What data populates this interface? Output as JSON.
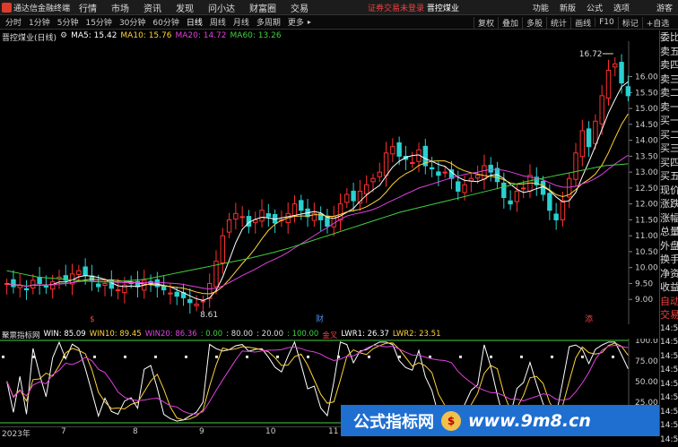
{
  "menubar": {
    "logo": "通达信金融终端",
    "items": [
      "行情",
      "市场",
      "资讯",
      "发现",
      "问小达",
      "财富圈",
      "交易"
    ],
    "notice": "证券交易未登录",
    "stock_notice": "晋控煤业",
    "right": [
      "功能",
      "新版",
      "公式",
      "选项",
      "游客"
    ]
  },
  "toolbar": {
    "periods": [
      "分时",
      "1分钟",
      "5分钟",
      "15分钟",
      "30分钟",
      "60分钟",
      "日线",
      "周线",
      "月线",
      "多周期",
      "更多"
    ],
    "active_period": "日线",
    "right": [
      "复权",
      "叠加",
      "多股",
      "统计",
      "画线",
      "F10",
      "标记",
      "+自选"
    ]
  },
  "title": {
    "stock": "晋控煤业(日线)",
    "ma5": "MA5: 15.42",
    "ma10": "MA10: 15.76",
    "ma20": "MA20: 14.72",
    "ma60": "MA60: 13.26"
  },
  "colors": {
    "ma5": "#ffffff",
    "ma10": "#ffd23a",
    "ma20": "#e040e0",
    "ma60": "#40d040",
    "up": "#ff3030",
    "down": "#2ad0d0"
  },
  "price_labels": {
    "high": "16.72",
    "low": "8.61"
  },
  "yaxis": [
    "16.00",
    "15.50",
    "15.00",
    "14.50",
    "14.00",
    "13.50",
    "13.00",
    "12.50",
    "12.00",
    "11.50",
    "11.00",
    "10.50",
    "10.00",
    "9.50",
    "9.00"
  ],
  "markers": [
    "$",
    "财",
    "添"
  ],
  "side_panel": [
    "委比",
    "卖五",
    "卖四",
    "卖三",
    "卖二",
    "卖一",
    "买一",
    "买二",
    "买三",
    "买四",
    "买五",
    "现价",
    "涨跌",
    "涨幅",
    "总量",
    "外盘",
    "换手",
    "净资",
    "收益",
    "自动",
    "交易",
    "14:5",
    "14:5",
    "14:5",
    "14:5",
    "14:5",
    "14:5",
    "14:5",
    "14:5",
    "14:5"
  ],
  "indicator": {
    "name": "聚票指标网",
    "win": "WIN: 85.09",
    "win10": "WIN10: 89.45",
    "win20": "WIN20: 86.36",
    "v1": ": 0.00",
    "v2": ": 80.00",
    "v3": ": 20.00",
    "v4": ": 100.00",
    "jincha": "金叉",
    "lwr1": "LWR1: 26.37",
    "lwr2": "LWR2: 23.51",
    "yaxis": [
      "100.0",
      "75.00",
      "50.00",
      "25.00"
    ]
  },
  "xaxis": [
    "2023年",
    "7",
    "8",
    "9",
    "10",
    "11"
  ],
  "watermark": {
    "text1": "公式指标网",
    "coin": "$",
    "text2": "www.9m8.cn"
  },
  "chart_data": {
    "type": "candlestick",
    "ylim": [
      8.5,
      17.0
    ],
    "close": [
      9.5,
      9.4,
      9.45,
      9.3,
      9.6,
      9.5,
      9.4,
      9.55,
      9.7,
      9.6,
      9.8,
      9.9,
      9.75,
      9.6,
      9.4,
      9.5,
      9.35,
      9.3,
      9.45,
      9.5,
      9.4,
      9.6,
      9.5,
      9.4,
      9.3,
      9.2,
      9.1,
      9.05,
      8.9,
      8.85,
      8.95,
      9.5,
      10.2,
      11.0,
      11.5,
      11.7,
      11.6,
      11.3,
      11.5,
      11.8,
      11.6,
      11.4,
      11.5,
      11.7,
      12.0,
      11.8,
      11.6,
      11.7,
      11.5,
      11.3,
      11.6,
      12.0,
      12.3,
      12.1,
      12.4,
      12.6,
      12.8,
      13.0,
      13.6,
      13.8,
      13.5,
      13.4,
      13.3,
      13.7,
      13.2,
      13.1,
      12.9,
      13.0,
      12.8,
      12.4,
      12.6,
      12.8,
      12.9,
      13.2,
      13.0,
      12.7,
      12.2,
      12.0,
      12.4,
      12.5,
      12.9,
      12.6,
      12.3,
      11.8,
      11.5,
      12.1,
      12.8,
      13.6,
      14.3,
      13.8,
      14.6,
      15.4,
      16.2,
      16.4,
      15.8,
      15.4
    ],
    "ma60": [
      9.9,
      9.85,
      9.8,
      9.75,
      9.7,
      9.68,
      9.66,
      9.64,
      9.62,
      9.6,
      9.58,
      9.56,
      9.55,
      9.55,
      9.56,
      9.58,
      9.6,
      9.62,
      9.65,
      9.7,
      9.75,
      9.8,
      9.85,
      9.9,
      9.95,
      10.0,
      10.05,
      10.1,
      10.15,
      10.2,
      10.25,
      10.3,
      10.36,
      10.42,
      10.48,
      10.55,
      10.62,
      10.7,
      10.78,
      10.86,
      10.94,
      11.02,
      11.1,
      11.18,
      11.26,
      11.34,
      11.42,
      11.5,
      11.58,
      11.66,
      11.74,
      11.8,
      11.86,
      11.92,
      11.98,
      12.04,
      12.1,
      12.16,
      12.22,
      12.28,
      12.34,
      12.4,
      12.46,
      12.52,
      12.58,
      12.64,
      12.7,
      12.75,
      12.8,
      12.85,
      12.9,
      12.95,
      13.0,
      13.05,
      13.1,
      13.15,
      13.2,
      13.22,
      13.24,
      13.26
    ]
  }
}
